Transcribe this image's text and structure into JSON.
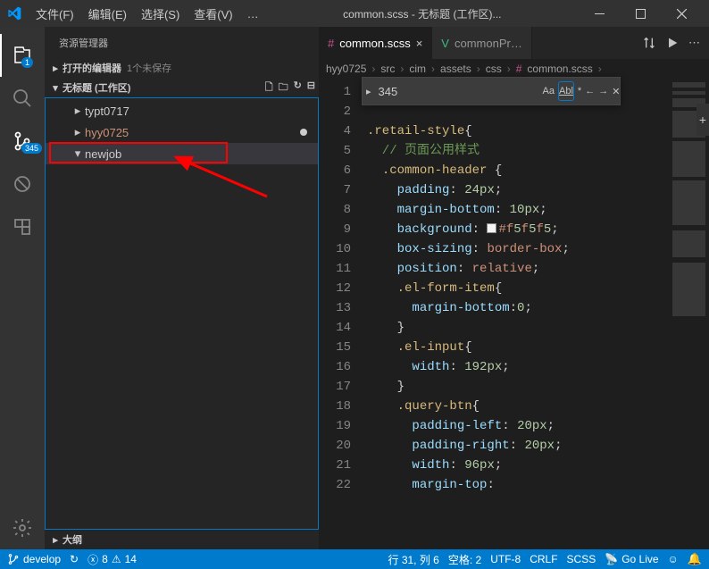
{
  "titlebar": {
    "menu": [
      "文件(F)",
      "编辑(E)",
      "选择(S)",
      "查看(V)",
      "…"
    ],
    "title": "common.scss - 无标题 (工作区)..."
  },
  "activitybar": {
    "explorer_badge": "1",
    "scm_badge": "345"
  },
  "sidebar": {
    "title": "资源管理器",
    "open_editors": {
      "label": "打开的编辑器",
      "count": "1个未保存"
    },
    "workspace_label": "无标题 (工作区)",
    "tree": [
      {
        "label": "typt0717",
        "level": 1,
        "expandable": true
      },
      {
        "label": "hyy0725",
        "level": 1,
        "expandable": true,
        "modified": true,
        "orange": true
      },
      {
        "label": "newjob",
        "level": 1,
        "expanded": true,
        "selected": true
      }
    ],
    "outline": "大纲"
  },
  "tabs": [
    {
      "label": "common.scss",
      "icon": "scss",
      "active": true
    },
    {
      "label": "commonPr…",
      "icon": "vue",
      "active": false
    }
  ],
  "breadcrumbs": [
    "hyy0725",
    "src",
    "cim",
    "assets",
    "css",
    "common.scss"
  ],
  "find": {
    "value": "345",
    "match_case": "Aa",
    "whole_word": "Abl",
    "regex": "*"
  },
  "code": {
    "start_line": 1,
    "lines": [
      "",
      "",
      ".retail-style{",
      "  // 页面公用样式",
      "  .common-header {",
      "    padding: 24px;",
      "    margin-bottom: 10px;",
      "    background: #f5f5f5;",
      "    box-sizing: border-box;",
      "    position: relative;",
      "    .el-form-item{",
      "      margin-bottom:0;",
      "    }",
      "    .el-input{",
      "      width: 192px;",
      "    }",
      "    .query-btn{",
      "      padding-left: 20px;",
      "      padding-right: 20px;",
      "      width: 96px;",
      "      margin-top:"
    ]
  },
  "statusbar": {
    "branch": "develop",
    "sync": "↻",
    "errors": "8",
    "warnings": "14",
    "cursor": "行 31, 列 6",
    "spaces": "空格: 2",
    "encoding": "UTF-8",
    "eol": "CRLF",
    "lang": "SCSS",
    "golive": "Go Live"
  }
}
